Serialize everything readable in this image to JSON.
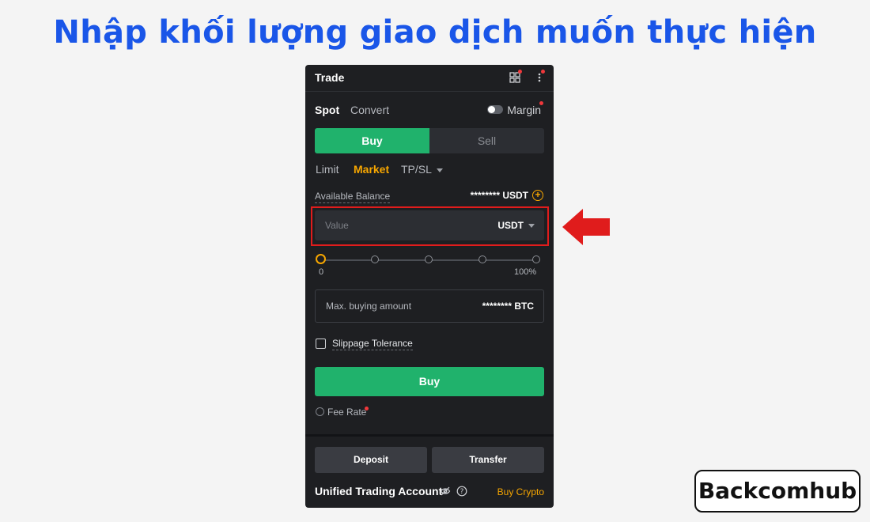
{
  "heading": "Nhập khối lượng giao dịch muốn thực hiện",
  "panel": {
    "title": "Trade",
    "mode_tabs": [
      "Spot",
      "Convert"
    ],
    "margin_label": "Margin",
    "buy_label": "Buy",
    "sell_label": "Sell",
    "order_types": [
      "Limit",
      "Market",
      "TP/SL"
    ],
    "available_balance_label": "Available Balance",
    "available_balance_value": "******** USDT",
    "value_placeholder": "Value",
    "value_unit": "USDT",
    "slider_min": "0",
    "slider_max": "100%",
    "slider_percent": 0,
    "max_buying_label": "Max. buying amount",
    "max_buying_value": "******** BTC",
    "slippage_label": "Slippage Tolerance",
    "buy_button": "Buy",
    "fee_rate_label": "Fee Rate",
    "deposit_label": "Deposit",
    "transfer_label": "Transfer",
    "account_label": "Unified Trading Account",
    "buy_crypto_label": "Buy Crypto"
  },
  "colors": {
    "heading": "#1a56e8",
    "panel_bg": "#1e1f22",
    "buy_green": "#20b26c",
    "accent_orange": "#f7a600",
    "highlight_red": "#e01c1c"
  },
  "icons": [
    "grid-icon",
    "more-vertical-icon",
    "plus-circle-icon",
    "chevron-down-icon",
    "fee-icon",
    "eye-hidden-icon",
    "help-icon",
    "red-arrow-icon"
  ],
  "brand": {
    "text": "Backcomhub"
  }
}
